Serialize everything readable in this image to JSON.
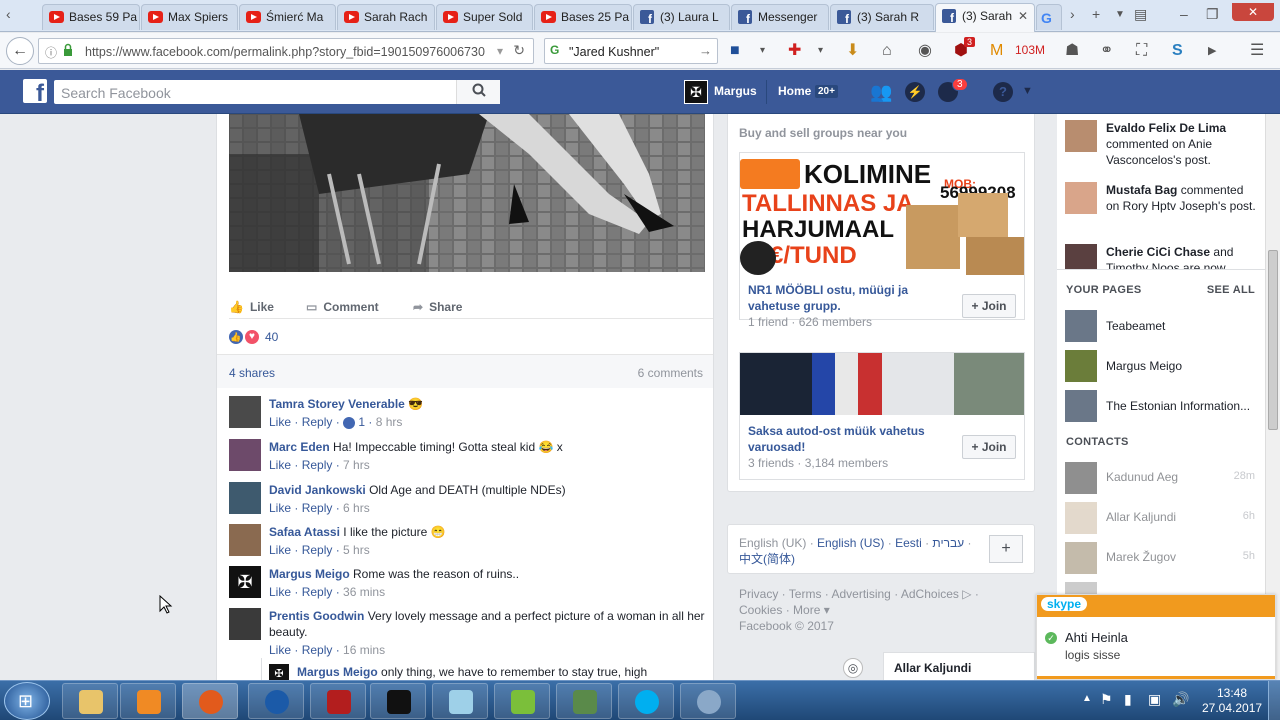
{
  "browser": {
    "tabs": [
      {
        "label": "Bases 59 Pa",
        "icon": "youtube-icon"
      },
      {
        "label": "Max Spiers",
        "icon": "youtube-icon"
      },
      {
        "label": "Śmierć Ma",
        "icon": "youtube-icon"
      },
      {
        "label": "Sarah Rach",
        "icon": "youtube-icon"
      },
      {
        "label": "Super Sold",
        "icon": "youtube-icon"
      },
      {
        "label": "Bases 25 Pa",
        "icon": "youtube-icon"
      },
      {
        "label": "(3) Laura L",
        "icon": "facebook-icon"
      },
      {
        "label": "Messenger",
        "icon": "facebook-icon"
      },
      {
        "label": "(3) Sarah R",
        "icon": "facebook-icon"
      },
      {
        "label": "(3) Sarah",
        "icon": "facebook-icon"
      }
    ],
    "url": "https://www.facebook.com/permalink.php?story_fbid=190150976006730",
    "search_value": "\"Jared Kushner\"",
    "toolbar_badges": {
      "ublock": "3",
      "memory": "103M"
    }
  },
  "fb": {
    "logo": "f",
    "search_placeholder": "Search Facebook",
    "user": "Margus",
    "home": "Home",
    "home_badge": "20+",
    "notif_badge": "3"
  },
  "post": {
    "actions": {
      "like": "Like",
      "comment": "Comment",
      "share": "Share"
    },
    "reactions_count": "40",
    "shares": "4 shares",
    "comments_count": "6 comments",
    "comments": [
      {
        "name": "Tamra Storey Venerable",
        "text": "😎",
        "like": "Like",
        "reply": "Reply",
        "likes": "1",
        "time": "8 hrs"
      },
      {
        "name": "Marc Eden",
        "text": "Ha! Impeccable timing! Gotta steal kid 😂 x",
        "like": "Like",
        "reply": "Reply",
        "time": "7 hrs"
      },
      {
        "name": "David Jankowski",
        "text": "Old Age and DEATH (multiple NDEs)",
        "like": "Like",
        "reply": "Reply",
        "time": "6 hrs"
      },
      {
        "name": "Safaa Atassi",
        "text": "I like the picture 😁",
        "like": "Like",
        "reply": "Reply",
        "time": "5 hrs"
      },
      {
        "name": "Margus Meigo",
        "text": "Rome was the reason of ruins..",
        "like": "Like",
        "reply": "Reply",
        "time": "36 mins"
      },
      {
        "name": "Prentis Goodwin",
        "text": "Very lovely message and a perfect picture of a woman in all her beauty.",
        "like": "Like",
        "reply": "Reply",
        "time": "16 mins"
      },
      {
        "name": "Margus Meigo",
        "text": "only thing, we have to remember to stay true, high"
      }
    ]
  },
  "groups": {
    "heading": "Buy and sell groups near you",
    "items": [
      {
        "title": "NR1 MÖÖBLI ostu, müügi ja vahetuse grupp.",
        "meta": "1 friend · 626 members",
        "join": "Join",
        "ad_line1": "KOLIMINE",
        "ad_line2": "TALLINNAS JA",
        "ad_line3": "HARJUMAAL",
        "ad_line4": "€/TUND",
        "ad_mob": "MOB:",
        "ad_phone": "56999208"
      },
      {
        "title": "Saksa autod-ost müük vahetus varuosad!",
        "meta": "3 friends · 3,184 members",
        "join": "Join"
      }
    ]
  },
  "footer": {
    "languages": [
      "English (UK)",
      "English (US)",
      "Eesti",
      "עברית",
      "中文(简体)"
    ],
    "links": [
      "Privacy",
      "Terms",
      "Advertising",
      "AdChoices",
      "Cookies",
      "More"
    ],
    "copyright": "Facebook © 2017",
    "chat_name": "Allar Kaljundi"
  },
  "ticker": [
    {
      "name": "Evaldo Felix De Lima",
      "text": "commented on Anie Vasconcelos's post."
    },
    {
      "name": "Mustafa Bag",
      "text": "commented on Rory Hptv Joseph's post."
    },
    {
      "name": "Cherie CiCi Chase",
      "text": "and Timothy Noos are now"
    }
  ],
  "your_pages": {
    "heading": "YOUR PAGES",
    "see_all": "SEE ALL",
    "items": [
      "Teabeamet",
      "Margus Meigo",
      "The Estonian Information..."
    ]
  },
  "contacts": {
    "heading": "CONTACTS",
    "items": [
      {
        "name": "Kadunud Aeg",
        "time": "28m"
      },
      {
        "name": "Allar Kaljundi",
        "time": "6h"
      },
      {
        "name": "Marek Žugov",
        "time": "5h"
      }
    ]
  },
  "skype": {
    "brand": "skype",
    "name": "Ahti Heinla",
    "status": "logis sisse"
  },
  "taskbar": {
    "time": "13:48",
    "date": "27.04.2017"
  }
}
